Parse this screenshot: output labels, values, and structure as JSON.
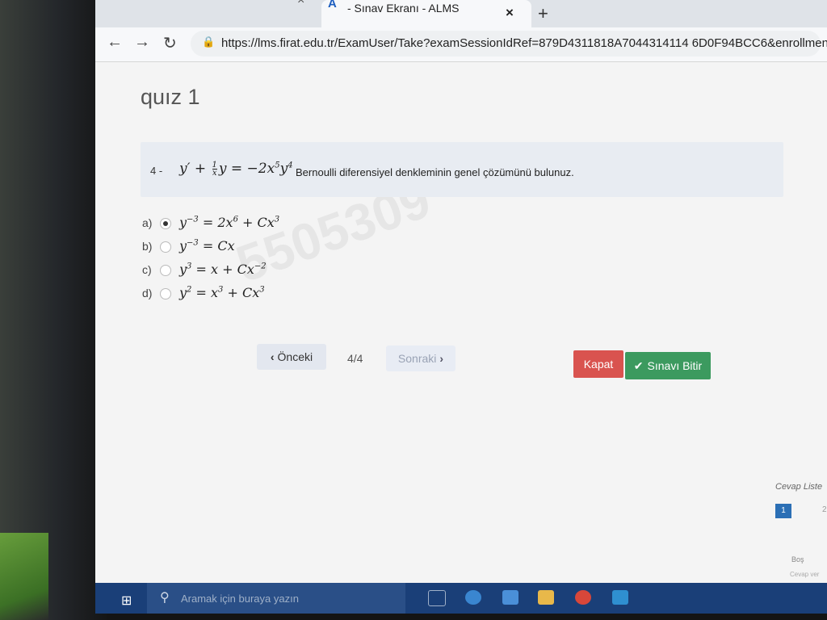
{
  "browser": {
    "tab_title": "- Sınav Ekranı - ALMS",
    "tab_favicon": "A",
    "close_glyph": "×",
    "new_tab_glyph": "+",
    "url": "https://lms.firat.edu.tr/ExamUser/Take?examSessionIdRef=879D4311818A7044314114 6D0F94BCC6&enrollmentIdRe"
  },
  "page": {
    "quiz_title": "quız 1",
    "question": {
      "number": "4 -",
      "text": "Bernoulli diferensiyel denkleminin genel çözümünü bulunuz."
    },
    "options": [
      {
        "label": "a)",
        "selected": true
      },
      {
        "label": "b)",
        "selected": false
      },
      {
        "label": "c)",
        "selected": false
      },
      {
        "label": "d)",
        "selected": false
      }
    ],
    "watermark": "5505309",
    "prev_label": "Önceki",
    "page_indicator": "4/4",
    "next_label": "Sonraki",
    "close_label": "Kapat",
    "finish_label": "Sınavı Bitir",
    "answer_list_title": "Cevap Liste",
    "answer_chip": "1",
    "answer_chip2": "2",
    "legend_empty": "Boş",
    "legend_answered": "Cevap ver"
  },
  "taskbar": {
    "search_placeholder": "Aramak için buraya yazın"
  },
  "colors": {
    "close_button": "#d9534f",
    "finish_button": "#3c9a5f",
    "taskbar": "#1a3f78"
  }
}
